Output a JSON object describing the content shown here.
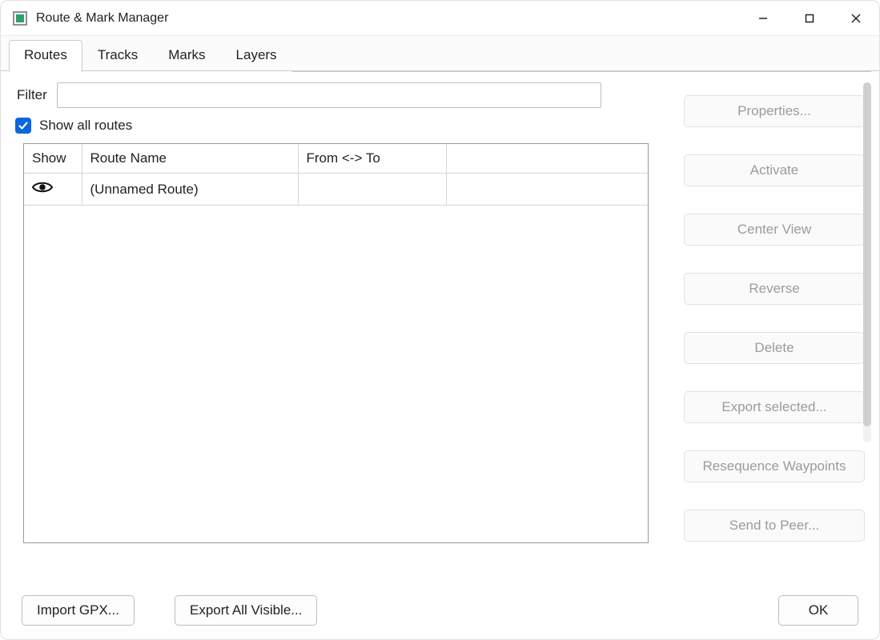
{
  "window": {
    "title": "Route & Mark Manager"
  },
  "tabs": [
    {
      "label": "Routes",
      "active": true
    },
    {
      "label": "Tracks",
      "active": false
    },
    {
      "label": "Marks",
      "active": false
    },
    {
      "label": "Layers",
      "active": false
    }
  ],
  "filter": {
    "label": "Filter",
    "value": ""
  },
  "show_all": {
    "checked": true,
    "label": "Show all routes"
  },
  "table": {
    "headers": {
      "show": "Show",
      "route_name": "Route Name",
      "from_to": "From <-> To",
      "extra": ""
    },
    "rows": [
      {
        "visible": true,
        "name": "(Unnamed Route)",
        "from_to": "",
        "extra": ""
      }
    ]
  },
  "side_buttons": {
    "properties": "Properties...",
    "activate": "Activate",
    "center_view": "Center View",
    "reverse": "Reverse",
    "delete": "Delete",
    "export_selected": "Export selected...",
    "resequence": "Resequence Waypoints",
    "send_to_peer": "Send to Peer..."
  },
  "bottom": {
    "import_gpx": "Import GPX...",
    "export_all_visible": "Export All Visible...",
    "ok": "OK"
  }
}
